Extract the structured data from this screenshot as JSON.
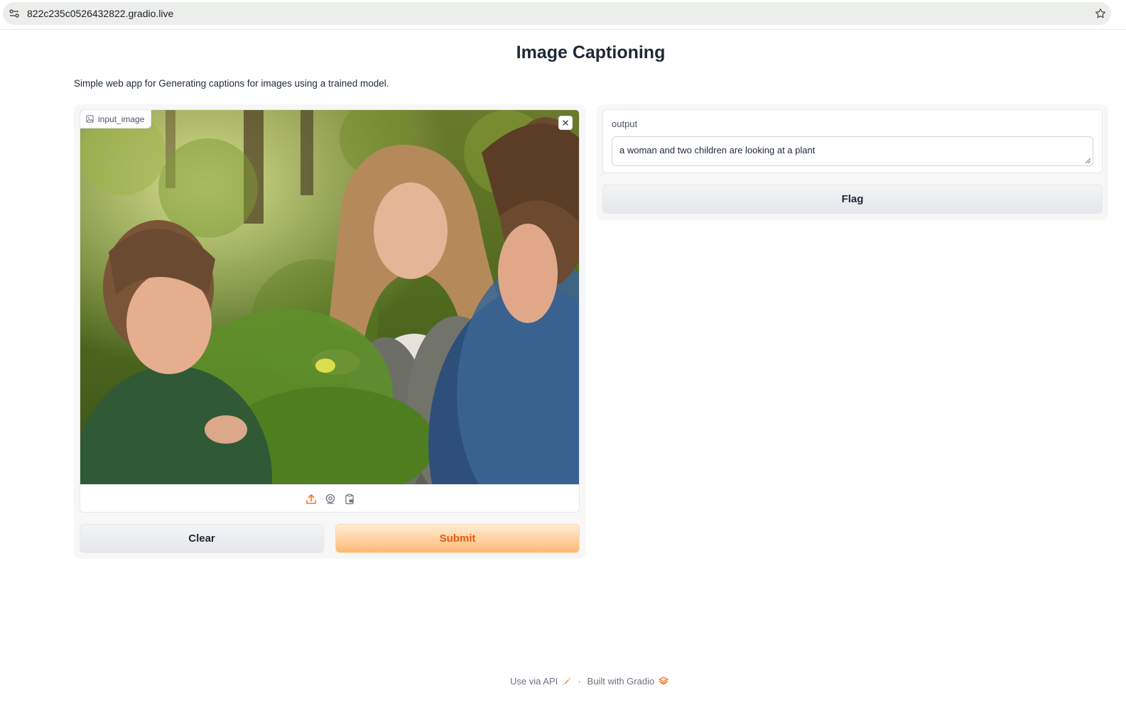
{
  "browser": {
    "url": "822c235c0526432822.gradio.live",
    "site_info_icon": "site-settings-icon",
    "bookmark_icon": "star-icon"
  },
  "header": {
    "title": "Image Captioning",
    "description": "Simple web app for Generating captions for images using a trained model."
  },
  "input": {
    "label": "input_image",
    "label_icon": "image-icon",
    "clear_icon": "close-icon",
    "sources": [
      {
        "name": "upload",
        "icon": "upload-icon",
        "active": true
      },
      {
        "name": "webcam",
        "icon": "webcam-icon",
        "active": false
      },
      {
        "name": "clipboard",
        "icon": "clipboard-icon",
        "active": false
      }
    ]
  },
  "buttons": {
    "clear": "Clear",
    "submit": "Submit",
    "flag": "Flag"
  },
  "output": {
    "label": "output",
    "value": "a woman and two children are looking at a plant"
  },
  "footer": {
    "api_link": "Use via API",
    "separator": "·",
    "built_with": "Built with Gradio"
  },
  "colors": {
    "accent": "#ea580c",
    "submit_gradient_start": "#ffedd5",
    "submit_gradient_end": "#fdba74",
    "panel_bg": "#f7f7f8"
  }
}
